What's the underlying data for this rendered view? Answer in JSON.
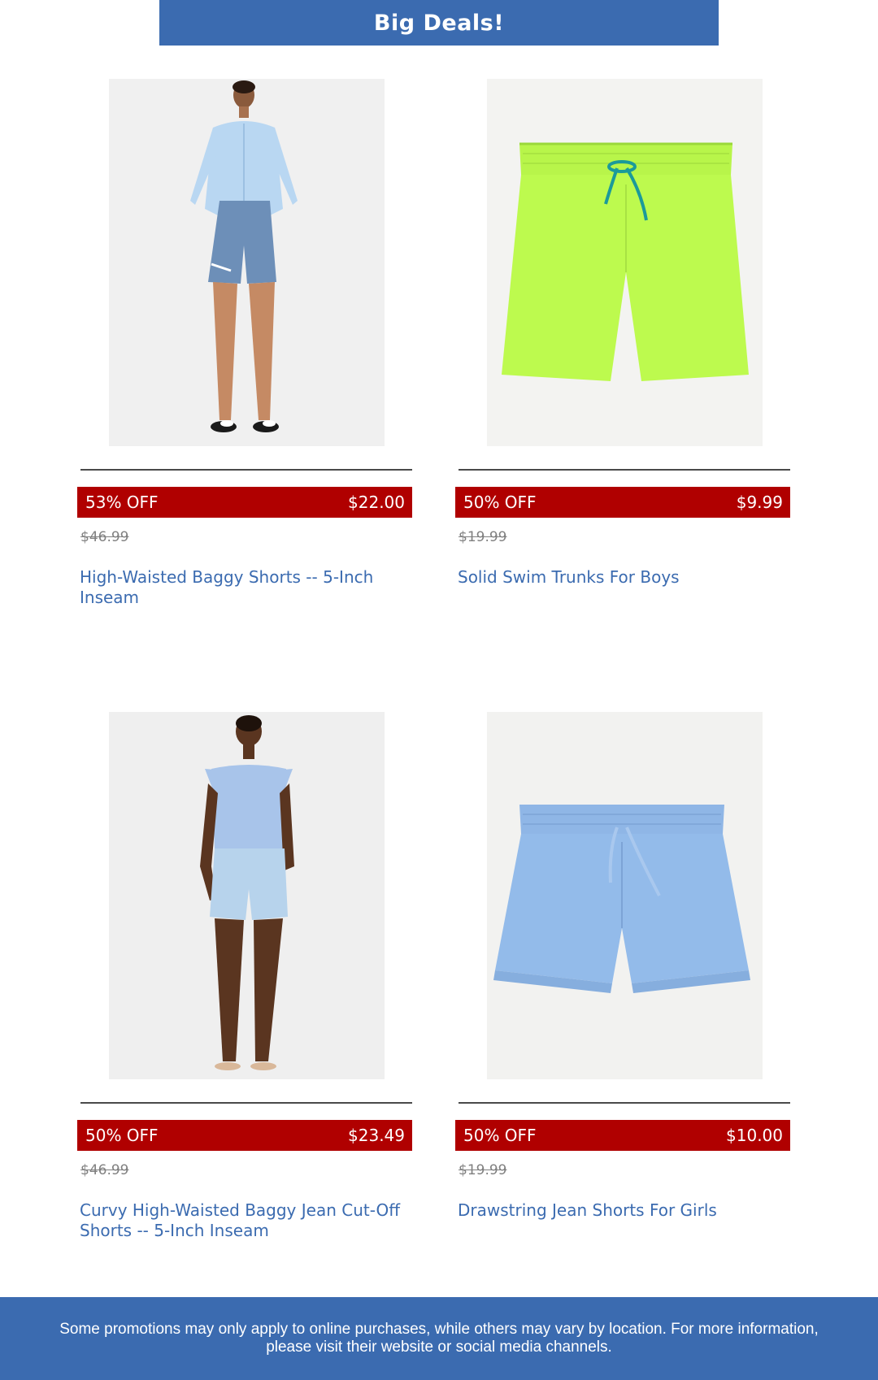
{
  "banner": {
    "title": "Big Deals!",
    "color": "#3b6bb0"
  },
  "colors": {
    "deal_bar": "#b00000",
    "link": "#3b6bb0",
    "strike_price": "#808080"
  },
  "products": [
    {
      "discount": "53% OFF",
      "price": "$22.00",
      "original_price": "$46.99",
      "name": "High-Waisted Baggy Shorts -- 5-Inch Inseam",
      "image": "woman-denim-shorts-cardigan-photo"
    },
    {
      "discount": "50% OFF",
      "price": "$9.99",
      "original_price": "$19.99",
      "name": "Solid Swim Trunks For Boys",
      "image": "green-swim-trunks-photo"
    },
    {
      "discount": "50% OFF",
      "price": "$23.49",
      "original_price": "$46.99",
      "name": "Curvy High-Waisted Baggy Jean Cut-Off Shorts -- 5-Inch Inseam",
      "image": "woman-jean-cutoffs-blouse-photo"
    },
    {
      "discount": "50% OFF",
      "price": "$10.00",
      "original_price": "$19.99",
      "name": "Drawstring Jean Shorts For Girls",
      "image": "chambray-drawstring-shorts-photo"
    }
  ],
  "footer": {
    "text": "Some promotions may only apply to online purchases, while others may vary by location. For more information, please visit their website or social media channels."
  }
}
